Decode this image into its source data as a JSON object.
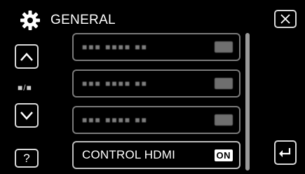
{
  "header": {
    "title": "GENERAL",
    "icon": "gear-icon"
  },
  "nav": {
    "page_indicator": "■/■",
    "help_label": "?"
  },
  "menu": {
    "items": [
      {
        "label": "■■■ ■■■■ ■■",
        "value": "",
        "state": "obscured"
      },
      {
        "label": "■■■ ■■■■ ■■",
        "value": "",
        "state": "obscured"
      },
      {
        "label": "■■■ ■■■■ ■■",
        "value": "",
        "state": "obscured"
      },
      {
        "label": "CONTROL HDMI",
        "value": "ON",
        "state": "active"
      }
    ]
  },
  "colors": {
    "background": "#000000",
    "border": "#d8d8d8",
    "text": "#ffffff"
  }
}
